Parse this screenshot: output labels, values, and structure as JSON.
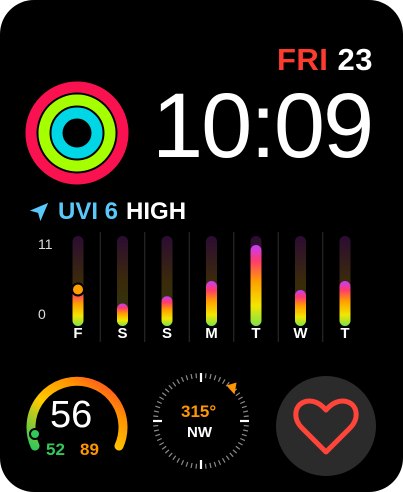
{
  "date": {
    "weekday": "FRI",
    "day": "23"
  },
  "time": "10:09",
  "uv": {
    "label": "UVI 6",
    "level": "HIGH"
  },
  "forecast": {
    "y_max_label": "11",
    "y_min_label": "0",
    "days": [
      {
        "label": "F",
        "level": 0.45,
        "highlight": true
      },
      {
        "label": "S",
        "level": 0.25
      },
      {
        "label": "S",
        "level": 0.33
      },
      {
        "label": "M",
        "level": 0.5
      },
      {
        "label": "T",
        "level": 0.9
      },
      {
        "label": "W",
        "level": 0.4
      },
      {
        "label": "T",
        "level": 0.5
      }
    ]
  },
  "activity_gauge": {
    "value": "56",
    "low": "52",
    "high": "89"
  },
  "compass": {
    "heading": "315°",
    "direction": "NW"
  },
  "colors": {
    "move": "#fa114f",
    "exercise": "#a6ff00",
    "stand": "#00d7e6",
    "uv_blue": "#5ac8fa",
    "accent_red": "#ff3b30",
    "accent_orange": "#ff9500"
  },
  "icons": {
    "location": "location-arrow-icon",
    "heart": "heart-icon"
  }
}
